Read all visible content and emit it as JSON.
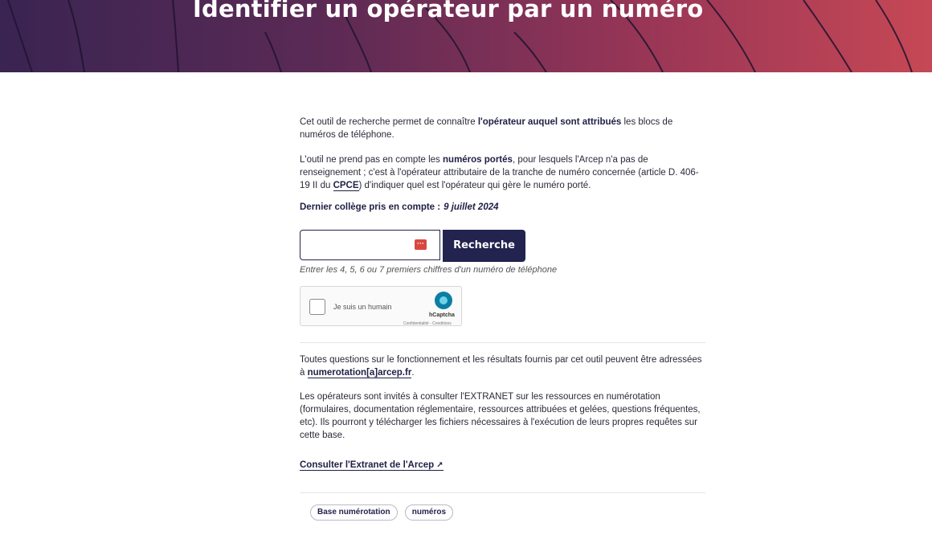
{
  "header": {
    "title": "Identifier un opérateur par un numéro"
  },
  "intro": {
    "p1_pre": "Cet outil de recherche permet de connaître ",
    "p1_bold": "l'opérateur auquel sont attribués",
    "p1_post": " les blocs de numéros de téléphone.",
    "p2_pre": "L'outil ne prend pas en compte les ",
    "p2_bold": "numéros portés",
    "p2_mid": ", pour lesquels l'Arcep n'a pas de renseignement ; c'est à l'opérateur attributaire de la tranche de numéro concernée (article D. 406-19 II du ",
    "p2_link": "CPCE",
    "p2_post": ") d'indiquer quel est l'opérateur qui gère le numéro porté.",
    "last_label": "Dernier collège pris en compte :",
    "last_date": "9 juillet 2024"
  },
  "search": {
    "input_value": "",
    "button_label": "Recherche",
    "hint": "Entrer les 4, 5, 6 ou 7 premiers chiffres d'un numéro de téléphone"
  },
  "captcha": {
    "label": "Je suis un humain",
    "brand": "hCaptcha",
    "sub": "Confidentialité - Conditions"
  },
  "footer_text": {
    "p4_pre": "Toutes questions sur le fonctionnement et les résultats fournis par cet outil peuvent être adressées à ",
    "p4_link": "numerotation[a]arcep.fr",
    "p4_post": ".",
    "p5": "Les opérateurs sont invités à consulter l'EXTRANET sur les ressources en numérotation (formulaires, documentation réglementaire, ressources attribuées et gelées, questions fréquentes, etc). Ils pourront y télécharger les fichiers nécessaires à l'exécution de leurs propres requêtes sur cette base.",
    "extranet_link": "Consulter l'Extranet de l'Arcep"
  },
  "tags": [
    "Base numérotation",
    "numéros"
  ],
  "colors": {
    "navy": "#23234f",
    "hero_start": "#3a2452",
    "hero_end": "#c64855"
  }
}
